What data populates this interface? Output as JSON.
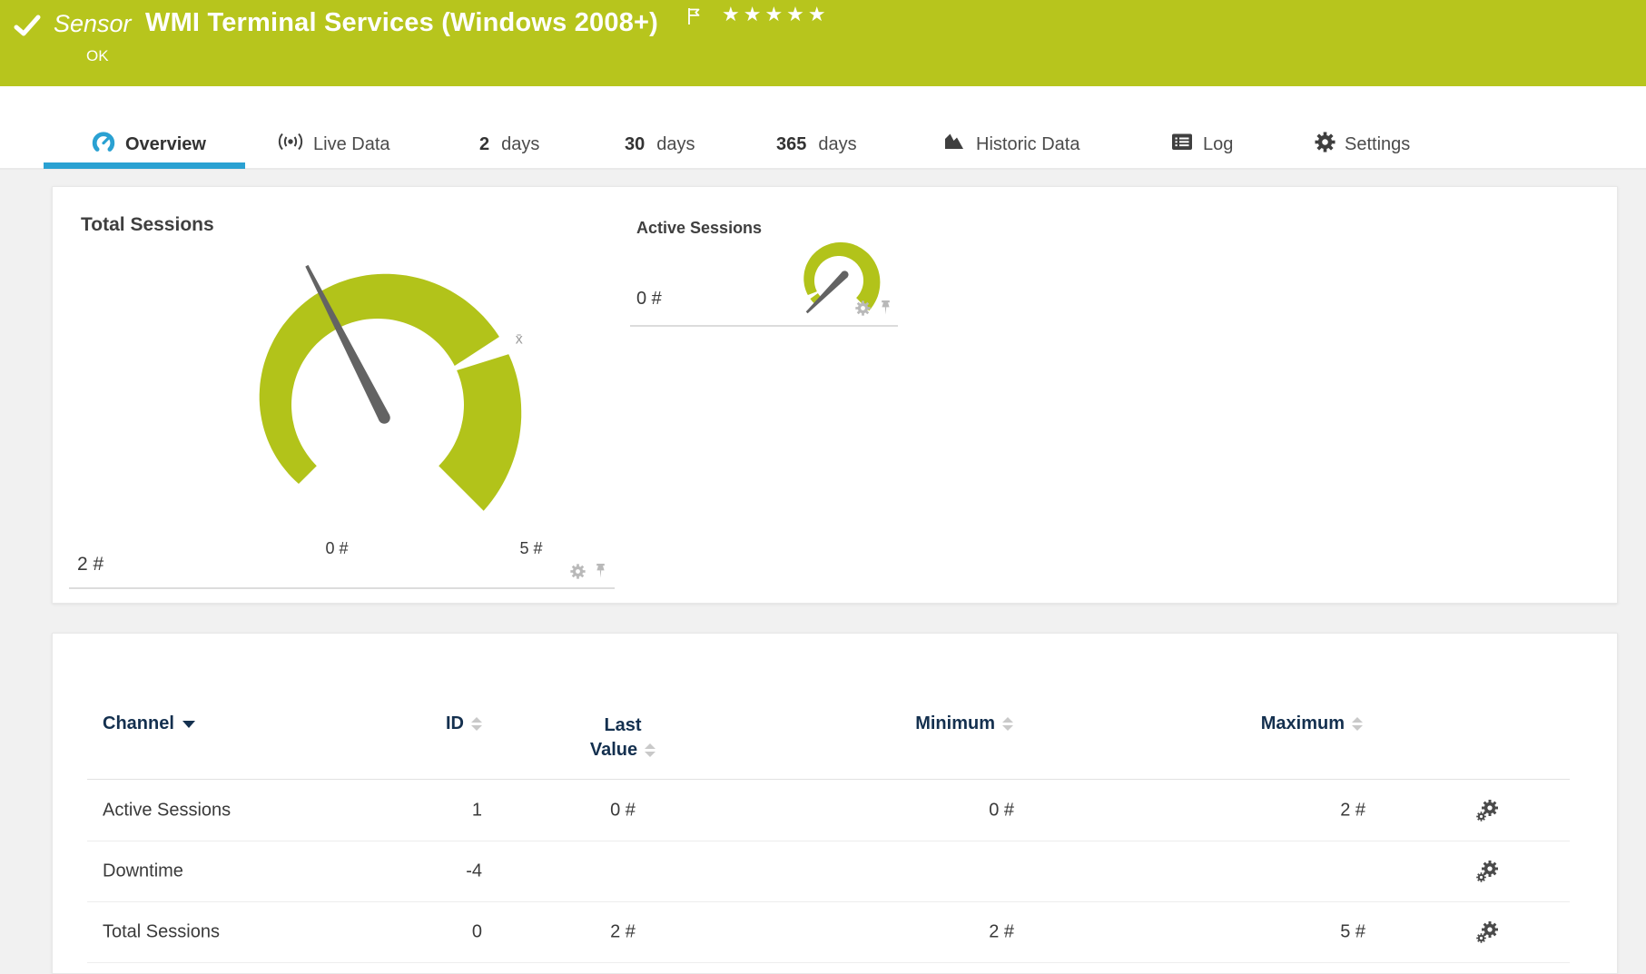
{
  "colors": {
    "accent_green": "#b7c51d",
    "gauge_green": "#b2c31a",
    "active_tab_blue": "#2aa1d2",
    "table_header_navy": "#14304f",
    "needle_gray": "#636363"
  },
  "header": {
    "breadcrumb": "Sensor",
    "title": "WMI Terminal Services (Windows 2008+)",
    "status": "OK",
    "rating_stars": "★★★★★"
  },
  "tabs": {
    "overview": "Overview",
    "live_data": "Live Data",
    "d2_num": "2",
    "d2_label": "days",
    "d30_num": "30",
    "d30_label": "days",
    "d365_num": "365",
    "d365_label": "days",
    "historic": "Historic Data",
    "log": "Log",
    "settings": "Settings"
  },
  "chart_data": [
    {
      "type": "gauge",
      "title": "Total Sessions",
      "unit": "#",
      "min": 0,
      "max": 5,
      "value": 2,
      "avg": 3.7,
      "min_label": "0 #",
      "max_label": "5 #",
      "value_label": "2 #",
      "avg_marker_label": "x̄"
    },
    {
      "type": "gauge",
      "title": "Active Sessions",
      "unit": "#",
      "min": 0,
      "max": 2,
      "value": 0,
      "avg": 0.12,
      "value_label": "0 #"
    }
  ],
  "table": {
    "sorted_column": "channel",
    "columns": {
      "channel": "Channel",
      "id": "ID",
      "last_line1": "Last",
      "last_line2": "Value",
      "minimum": "Minimum",
      "maximum": "Maximum"
    },
    "rows": [
      {
        "channel": "Active Sessions",
        "id": "1",
        "last": "0 #",
        "min": "0 #",
        "max": "2 #"
      },
      {
        "channel": "Downtime",
        "id": "-4",
        "last": "",
        "min": "",
        "max": ""
      },
      {
        "channel": "Total Sessions",
        "id": "0",
        "last": "2 #",
        "min": "2 #",
        "max": "5 #"
      }
    ]
  }
}
